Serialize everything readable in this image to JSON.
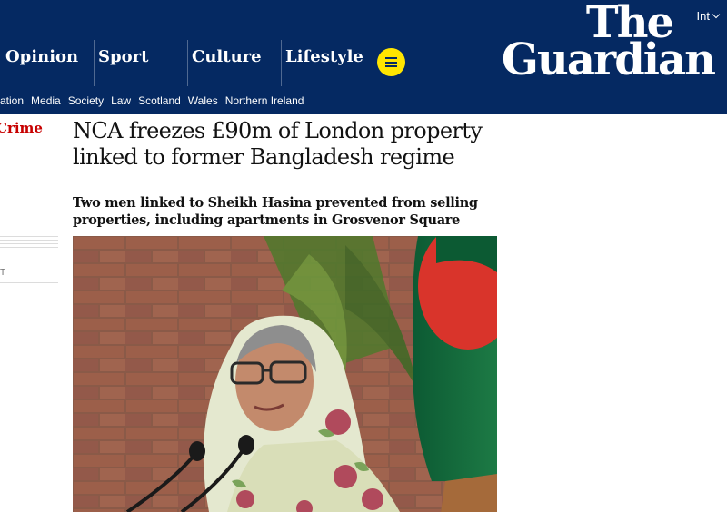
{
  "header": {
    "edition": "Int",
    "logo_line1": "The",
    "logo_line2": "Guardian",
    "pillars": [
      "Opinion",
      "Sport",
      "Culture",
      "Lifestyle"
    ],
    "colors": {
      "brand": "#052962",
      "menu_button": "#ffe500",
      "section": "#c70000"
    }
  },
  "subnav": {
    "items": [
      "Education",
      "Media",
      "Society",
      "Law",
      "Scotland",
      "Wales",
      "Northern Ireland"
    ],
    "first_visible": "cation"
  },
  "left": {
    "section_label": "Crime",
    "meta": "T"
  },
  "article": {
    "headline": "NCA freezes £90m of London property linked to former Bangladesh regime",
    "standfirst": "Two men linked to Sheikh Hasina prevented from selling properties, including apartments in Grosvenor Square"
  },
  "icons": {
    "menu": "hamburger-icon",
    "edition": "chevron-down-icon"
  }
}
